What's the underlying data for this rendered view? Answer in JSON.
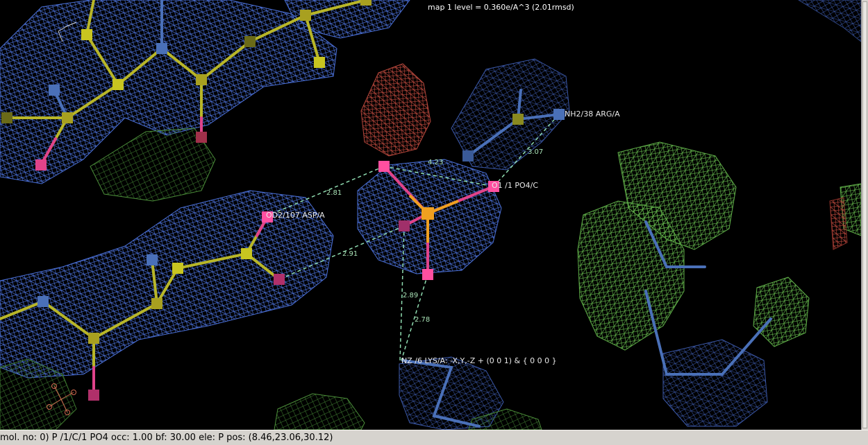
{
  "viewer": {
    "map_level": "map 1 level = 0.360e/A^3 (2.01rmsd)",
    "atom_labels": {
      "arg": "NH2/38 ARG/A",
      "po4": "O1 /1 PO4/C",
      "asp": "OD2/107 ASP/A",
      "lys": "NZ /6 LYS/A: -X,Y,-Z + (0 0 1) & { 0 0 0 }"
    },
    "distances": {
      "d1": "2.81",
      "d2": "4.23",
      "d3": "3.07",
      "d4": "2.91",
      "d5": "2.89",
      "d6": "2.78"
    },
    "colors": {
      "background": "#000000",
      "map_2fofc": "#4a6fd6",
      "map_diff_positive": "#5fae48",
      "map_diff_negative": "#b8473c",
      "carbon_yellow": "#b8b628",
      "carbon_blue": "#4a70b8",
      "oxygen": "#e0438a",
      "phosphorus": "#f0a020",
      "distance_line": "#8fdcb0"
    }
  },
  "statusbar": {
    "text": "mol. no: 0)  P  /1/C/1 PO4 occ: 1.00 bf: 30.00 ele:  P pos: (8.46,23.06,30.12)"
  }
}
